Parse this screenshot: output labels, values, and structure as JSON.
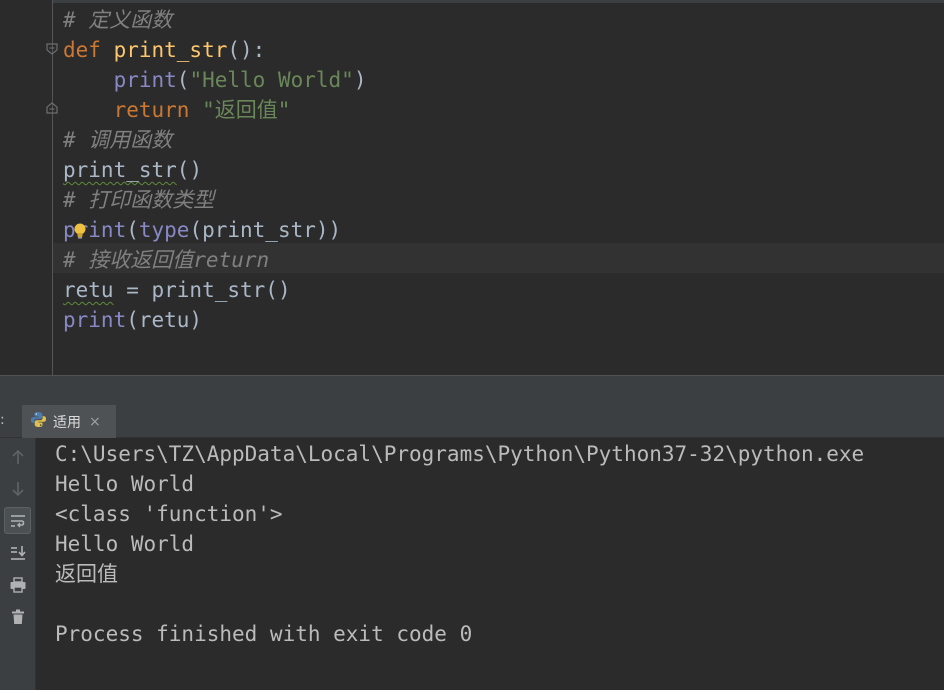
{
  "editor": {
    "lines": [
      {
        "tokens": [
          {
            "t": "# 定义函数",
            "c": "cm"
          }
        ]
      },
      {
        "tokens": [
          {
            "t": "def ",
            "c": "kw"
          },
          {
            "t": "print_str",
            "c": "fn"
          },
          {
            "t": "():",
            "c": ""
          }
        ]
      },
      {
        "tokens": [
          {
            "t": "    ",
            "c": ""
          },
          {
            "t": "print",
            "c": "bi"
          },
          {
            "t": "(",
            "c": ""
          },
          {
            "t": "\"Hello World\"",
            "c": "str"
          },
          {
            "t": ")",
            "c": ""
          }
        ]
      },
      {
        "tokens": [
          {
            "t": "    ",
            "c": ""
          },
          {
            "t": "return ",
            "c": "kw"
          },
          {
            "t": "\"返回值\"",
            "c": "str"
          }
        ]
      },
      {
        "tokens": [
          {
            "t": "# 调用函数",
            "c": "cm"
          }
        ]
      },
      {
        "tokens": [
          {
            "t": "print_str",
            "c": "wavy"
          },
          {
            "t": "()",
            "c": ""
          }
        ]
      },
      {
        "tokens": [
          {
            "t": "# 打印函数类型",
            "c": "cm"
          }
        ]
      },
      {
        "tokens": [
          {
            "t": "print",
            "c": "bi"
          },
          {
            "t": "(",
            "c": ""
          },
          {
            "t": "type",
            "c": "bi"
          },
          {
            "t": "(print_str))",
            "c": ""
          }
        ]
      },
      {
        "tokens": [
          {
            "t": "# 接收返回值return",
            "c": "cm"
          }
        ]
      },
      {
        "tokens": [
          {
            "t": "retu",
            "c": "wavy"
          },
          {
            "t": " = print_str()",
            "c": ""
          }
        ]
      },
      {
        "tokens": [
          {
            "t": "print",
            "c": "bi"
          },
          {
            "t": "(retu)",
            "c": ""
          }
        ]
      }
    ]
  },
  "run_panel": {
    "prefix": ":",
    "tab_label": "适用",
    "tab_close": "×",
    "tools": [
      "arrow-up-icon",
      "arrow-down-icon",
      "soft-wrap-icon",
      "scroll-to-end-icon",
      "print-icon",
      "trash-icon"
    ],
    "output": [
      "C:\\Users\\TZ\\AppData\\Local\\Programs\\Python\\Python37-32\\python.exe",
      "Hello World",
      "<class 'function'>",
      "Hello World",
      "返回值",
      "",
      "Process finished with exit code 0"
    ]
  },
  "colors": {
    "background": "#2b2b2b",
    "keyword": "#cc7832",
    "function_def": "#ffc66d",
    "builtin": "#8888c6",
    "string": "#6a8759",
    "comment": "#808080",
    "text": "#a9b7c6"
  }
}
